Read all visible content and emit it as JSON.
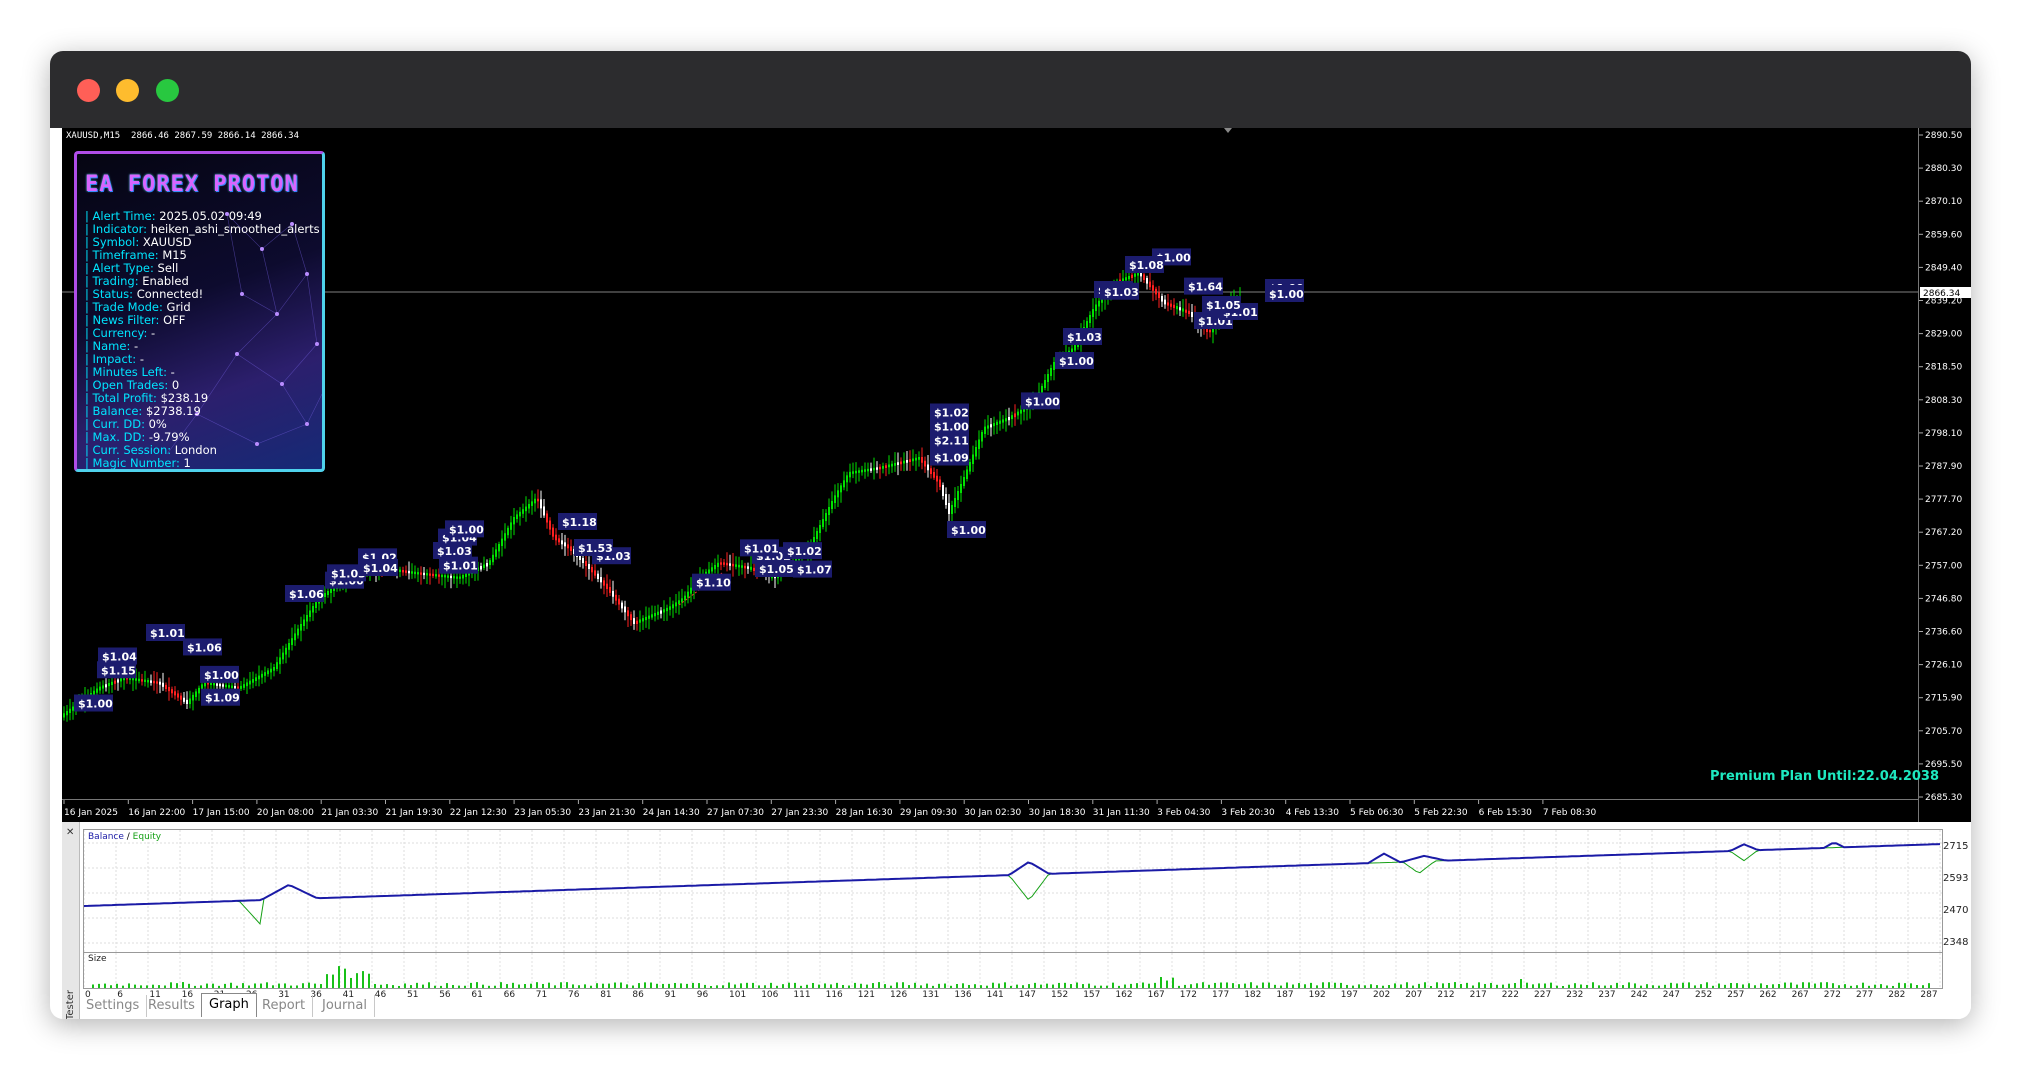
{
  "window": {
    "controls": [
      "close",
      "minimize",
      "maximize"
    ]
  },
  "chart": {
    "symbol_line": "XAUUSD,M15  2866.46 2867.59 2866.14 2866.34",
    "current_price": "2866.34",
    "premium_text": "Premium Plan Until:22.04.2038",
    "price_ticks": [
      "2890.50",
      "2880.30",
      "2870.10",
      "2859.60",
      "2849.40",
      "2839.20",
      "2829.00",
      "2818.50",
      "2808.30",
      "2798.10",
      "2787.90",
      "2777.70",
      "2767.20",
      "2757.00",
      "2746.80",
      "2736.60",
      "2726.10",
      "2715.90",
      "2705.70",
      "2695.50",
      "2685.30"
    ],
    "time_ticks": [
      "16 Jan 2025",
      "16 Jan 22:00",
      "17 Jan 15:00",
      "20 Jan 08:00",
      "21 Jan 03:30",
      "21 Jan 19:30",
      "22 Jan 12:30",
      "23 Jan 05:30",
      "23 Jan 21:30",
      "24 Jan 14:30",
      "27 Jan 07:30",
      "27 Jan 23:30",
      "28 Jan 16:30",
      "29 Jan 09:30",
      "30 Jan 02:30",
      "30 Jan 18:30",
      "31 Jan 11:30",
      "3 Feb 04:30",
      "3 Feb 20:30",
      "4 Feb 13:30",
      "5 Feb 06:30",
      "5 Feb 22:30",
      "6 Feb 15:30",
      "7 Feb 08:30"
    ],
    "profit_labels": [
      "$1.00",
      "$1.15",
      "$1.04",
      "$1.01",
      "$1.06",
      "$1.09",
      "$1.00",
      "$1.06",
      "$1.00",
      "$1.03",
      "$1.02",
      "$1.04",
      "$1.03",
      "$1.04",
      "$1.01",
      "$1.00",
      "$1.18",
      "$1.03",
      "$1.53",
      "$1.10",
      "$1.02",
      "$1.05",
      "$1.01",
      "$1.07",
      "$1.02",
      "$1.00",
      "$1.02",
      "$2.11",
      "$1.09",
      "$1.00",
      "$1.00",
      "$1.00",
      "$1.03",
      "$1.02",
      "$1.03",
      "$1.00",
      "$1.64",
      "$1.01",
      "$1.01",
      "$1.05",
      "$1.00",
      "$1.08",
      "$1.00"
    ]
  },
  "ea_panel": {
    "title": "EA FOREX PROTON",
    "rows": [
      {
        "label": "Alert Time:",
        "value": "2025.05.02 09:49"
      },
      {
        "label": "Indicator:",
        "value": "heiken_ashi_smoothed_alerts"
      },
      {
        "label": "Symbol:",
        "value": "XAUUSD"
      },
      {
        "label": "Timeframe:",
        "value": "M15"
      },
      {
        "label": "Alert Type:",
        "value": "Sell"
      },
      {
        "label": "Trading:",
        "value": "Enabled"
      },
      {
        "label": "Status:",
        "value": "Connected!"
      },
      {
        "label": "Trade Mode:",
        "value": "Grid"
      },
      {
        "label": "News Filter:",
        "value": "OFF"
      },
      {
        "label": "Currency:",
        "value": "-"
      },
      {
        "label": "Name:",
        "value": "-"
      },
      {
        "label": "Impact:",
        "value": "-"
      },
      {
        "label": "Minutes Left:",
        "value": "-"
      },
      {
        "label": "Open Trades:",
        "value": "0"
      },
      {
        "label": "Total Profit:",
        "value": "$238.19"
      },
      {
        "label": "Balance:",
        "value": "$2738.19"
      },
      {
        "label": "Curr. DD:",
        "value": "0%"
      },
      {
        "label": "Max. DD:",
        "value": "-9.79%"
      },
      {
        "label": "Curr. Session:",
        "value": "London"
      },
      {
        "label": "Magic Number:",
        "value": "1"
      }
    ]
  },
  "tester": {
    "side_label": "Tester",
    "legend_balance": "Balance",
    "legend_sep": " / ",
    "legend_equity": "Equity",
    "size_label": "Size",
    "y_ticks": [
      "2715",
      "2593",
      "2470",
      "2348"
    ],
    "x_ticks": [
      "0",
      "6",
      "11",
      "16",
      "21",
      "26",
      "31",
      "36",
      "41",
      "46",
      "51",
      "56",
      "61",
      "66",
      "71",
      "76",
      "81",
      "86",
      "91",
      "96",
      "101",
      "106",
      "111",
      "116",
      "121",
      "126",
      "131",
      "136",
      "141",
      "147",
      "152",
      "157",
      "162",
      "167",
      "172",
      "177",
      "182",
      "187",
      "192",
      "197",
      "202",
      "207",
      "212",
      "217",
      "222",
      "227",
      "232",
      "237",
      "242",
      "247",
      "252",
      "257",
      "262",
      "267",
      "272",
      "277",
      "282",
      "287"
    ],
    "tabs": [
      "Settings",
      "Results",
      "Graph",
      "Report",
      "Journal"
    ],
    "active_tab": "Graph"
  },
  "colors": {
    "bull": "#00e000",
    "bear": "#ff2020",
    "label_bg": "#1c1c6e",
    "balance": "#1a1aa6",
    "equity": "#15a015",
    "premium": "#1ee8c0"
  }
}
